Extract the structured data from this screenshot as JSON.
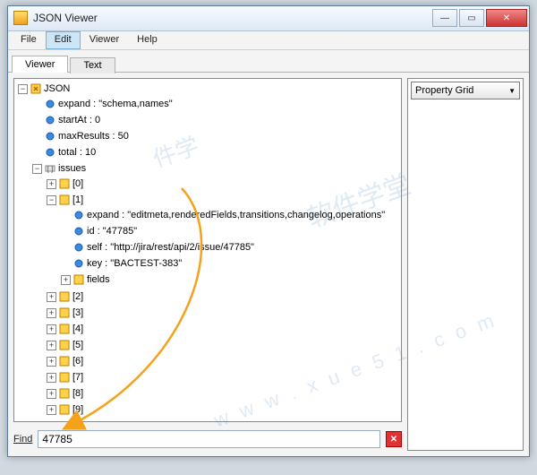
{
  "window": {
    "title": "JSON Viewer"
  },
  "menu": {
    "file": "File",
    "edit": "Edit",
    "viewer": "Viewer",
    "help": "Help"
  },
  "tabs": {
    "viewer": "Viewer",
    "text": "Text"
  },
  "tree": {
    "root": "JSON",
    "expand": "expand : \"schema,names\"",
    "startAt": "startAt : 0",
    "maxResults": "maxResults : 50",
    "total": "total : 10",
    "issues": "issues",
    "idx0": "[0]",
    "idx1": "[1]",
    "idx1_expand": "expand : \"editmeta,renderedFields,transitions,changelog,operations\"",
    "idx1_id": "id : \"47785\"",
    "idx1_self": "self : \"http://jira/rest/api/2/issue/47785\"",
    "idx1_key": "key : \"BACTEST-383\"",
    "idx1_fields": "fields",
    "idx2": "[2]",
    "idx3": "[3]",
    "idx4": "[4]",
    "idx5": "[5]",
    "idx6": "[6]",
    "idx7": "[7]",
    "idx8": "[8]",
    "idx9": "[9]"
  },
  "find": {
    "label": "Find",
    "value": "47785"
  },
  "propgrid": {
    "title": "Property Grid"
  },
  "watermark": {
    "t1": "软件学堂",
    "t2": "w w w . x u e 5 1 . c o m",
    "t3": "件学"
  }
}
